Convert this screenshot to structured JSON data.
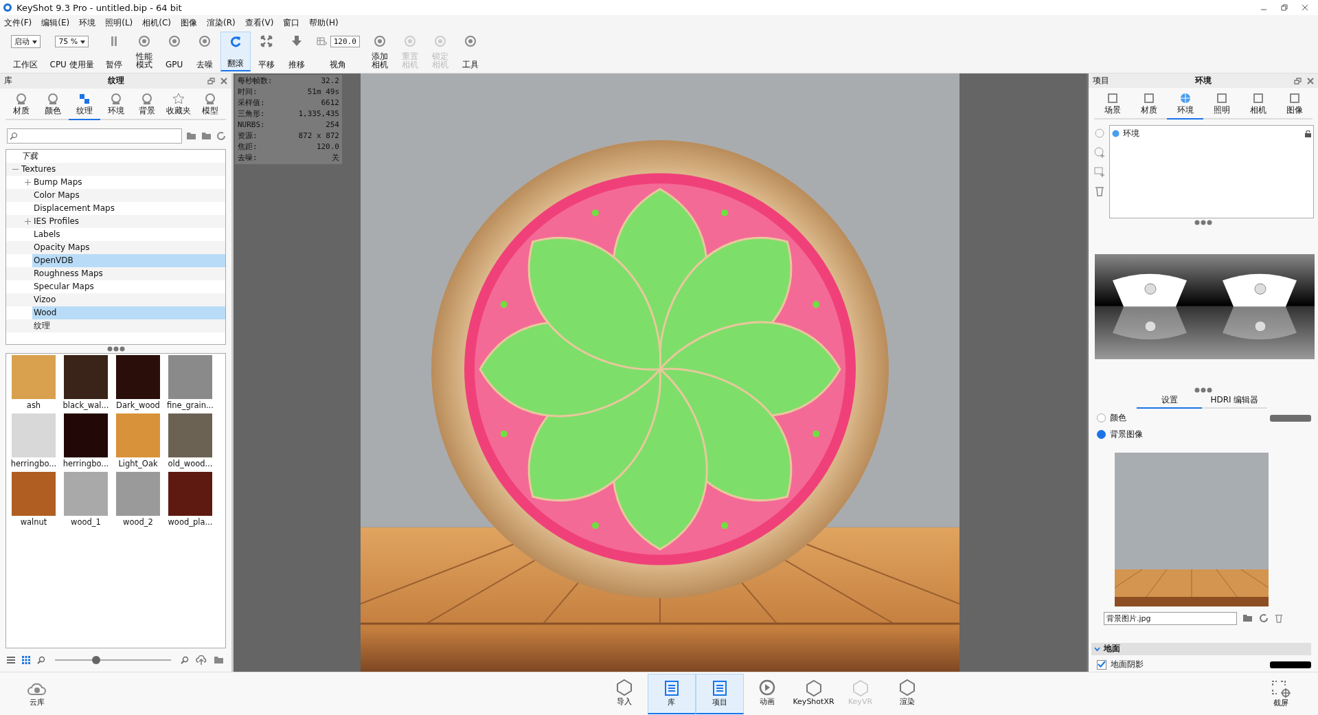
{
  "window": {
    "title": "KeyShot 9.3 Pro  - untitled.bip  - 64 bit"
  },
  "menu": [
    "文件(F)",
    "编辑(E)",
    "环境",
    "照明(L)",
    "相机(C)",
    "图像",
    "渲染(R)",
    "查看(V)",
    "窗口",
    "帮助(H)"
  ],
  "toolbar": [
    {
      "kind": "dropdown",
      "value": "启动",
      "label": "工作区",
      "selected": false,
      "disabled": false
    },
    {
      "kind": "dropdown",
      "value": "75 %",
      "label": "CPU 使用量",
      "selected": false,
      "disabled": false
    },
    {
      "kind": "button",
      "label": "暂停",
      "selected": false,
      "disabled": false
    },
    {
      "kind": "button",
      "label": "性能模式",
      "selected": false,
      "disabled": false
    },
    {
      "kind": "button",
      "label": "GPU",
      "selected": false,
      "disabled": false
    },
    {
      "kind": "button",
      "label": "去噪",
      "selected": false,
      "disabled": false
    },
    {
      "kind": "button",
      "label": "翻滚",
      "selected": true,
      "disabled": false
    },
    {
      "kind": "button",
      "label": "平移",
      "selected": false,
      "disabled": false
    },
    {
      "kind": "button",
      "label": "推移",
      "selected": false,
      "disabled": false
    },
    {
      "kind": "input",
      "value": "120.0",
      "label": "视角",
      "selected": false,
      "disabled": false
    },
    {
      "kind": "button",
      "label": "添加相机",
      "selected": false,
      "disabled": false
    },
    {
      "kind": "button",
      "label": "重置相机",
      "selected": false,
      "disabled": true
    },
    {
      "kind": "button",
      "label": "锁定相机",
      "selected": false,
      "disabled": true
    },
    {
      "kind": "button",
      "label": "工具",
      "selected": false,
      "disabled": false
    }
  ],
  "library": {
    "name": "库",
    "title": "纹理",
    "tabs": [
      {
        "label": "材质",
        "selected": false
      },
      {
        "label": "颜色",
        "selected": false
      },
      {
        "label": "纹理",
        "selected": true
      },
      {
        "label": "环境",
        "selected": false
      },
      {
        "label": "背景",
        "selected": false
      },
      {
        "label": "收藏夹",
        "selected": false
      },
      {
        "label": "模型",
        "selected": false
      }
    ],
    "tree": [
      {
        "label": "下载",
        "kind": "item",
        "selected": false
      },
      {
        "label": "Textures",
        "kind": "group",
        "expanded": true,
        "selected": false,
        "children": [
          {
            "label": "Bump Maps",
            "kind": "group",
            "expanded": false,
            "selected": false
          },
          {
            "label": "Color Maps",
            "kind": "item",
            "selected": false
          },
          {
            "label": "Displacement Maps",
            "kind": "item",
            "selected": false
          },
          {
            "label": "IES Profiles",
            "kind": "group",
            "expanded": false,
            "selected": false
          },
          {
            "label": "Labels",
            "kind": "item",
            "selected": false
          },
          {
            "label": "Opacity Maps",
            "kind": "item",
            "selected": false
          },
          {
            "label": "OpenVDB",
            "kind": "item",
            "selected": true
          },
          {
            "label": "Roughness Maps",
            "kind": "item",
            "selected": false
          },
          {
            "label": "Specular Maps",
            "kind": "item",
            "selected": false
          },
          {
            "label": "Vizoo",
            "kind": "item",
            "selected": false
          },
          {
            "label": "Wood",
            "kind": "item",
            "selected": true
          },
          {
            "label": "纹理",
            "kind": "item",
            "selected": false
          }
        ]
      }
    ],
    "thumbnails": [
      {
        "name": "ash",
        "color": "#d9a04e"
      },
      {
        "name": "black_wal...",
        "color": "#3a2318"
      },
      {
        "name": "Dark_wood",
        "color": "#2a0e0a"
      },
      {
        "name": "fine_grain...",
        "color": "#8a8a8a"
      },
      {
        "name": "herringbo...",
        "color": "#d8d8d8"
      },
      {
        "name": "herringbo...",
        "color": "#220806"
      },
      {
        "name": "Light_Oak",
        "color": "#d8923a"
      },
      {
        "name": "old_wood...",
        "color": "#6c6254"
      },
      {
        "name": "walnut",
        "color": "#b05e22"
      },
      {
        "name": "wood_1",
        "color": "#a9a9a9"
      },
      {
        "name": "wood_2",
        "color": "#9a9a9a"
      },
      {
        "name": "wood_pla...",
        "color": "#5e1a10"
      }
    ],
    "zoom": {
      "level": 0.35
    }
  },
  "stats": [
    {
      "label": "每秒帧数:",
      "value": "32.2"
    },
    {
      "label": "时间:",
      "value": "51m 49s"
    },
    {
      "label": "采样值:",
      "value": "6612"
    },
    {
      "label": "三角形:",
      "value": "1,335,435"
    },
    {
      "label": "NURBS:",
      "value": "254"
    },
    {
      "label": "资源:",
      "value": "872 x 872"
    },
    {
      "label": "焦距:",
      "value": "120.0"
    },
    {
      "label": "去噪:",
      "value": "关"
    }
  ],
  "project": {
    "name": "项目",
    "title": "环境",
    "tabs": [
      {
        "label": "场景",
        "selected": false
      },
      {
        "label": "材质",
        "selected": false
      },
      {
        "label": "环境",
        "selected": true
      },
      {
        "label": "照明",
        "selected": false
      },
      {
        "label": "相机",
        "selected": false
      },
      {
        "label": "图像",
        "selected": false
      }
    ],
    "environments": [
      {
        "label": "环境",
        "selected": false
      }
    ],
    "subtabs": [
      {
        "label": "设置",
        "selected": true
      },
      {
        "label": "HDRI 编辑器",
        "selected": false
      }
    ],
    "background_options": [
      {
        "label": "颜色",
        "selected": false,
        "color": "#6e6e6e"
      },
      {
        "label": "背景图像",
        "selected": true
      }
    ],
    "background_file": "背景图片.jpg",
    "ground": {
      "title": "地面",
      "expanded": true,
      "options": [
        {
          "label": "地面阴影",
          "checked": true,
          "color": "#000000"
        }
      ]
    }
  },
  "bottom_bar": {
    "left": "云库",
    "center": [
      {
        "label": "导入",
        "selected": false,
        "disabled": false
      },
      {
        "label": "库",
        "selected": true,
        "disabled": false
      },
      {
        "label": "项目",
        "selected": true,
        "disabled": false
      },
      {
        "label": "动画",
        "selected": false,
        "disabled": false
      },
      {
        "label": "KeyShotXR",
        "selected": false,
        "disabled": false
      },
      {
        "label": "KeyVR",
        "selected": false,
        "disabled": true
      },
      {
        "label": "渲染",
        "selected": false,
        "disabled": false
      }
    ],
    "right": "截屏"
  }
}
